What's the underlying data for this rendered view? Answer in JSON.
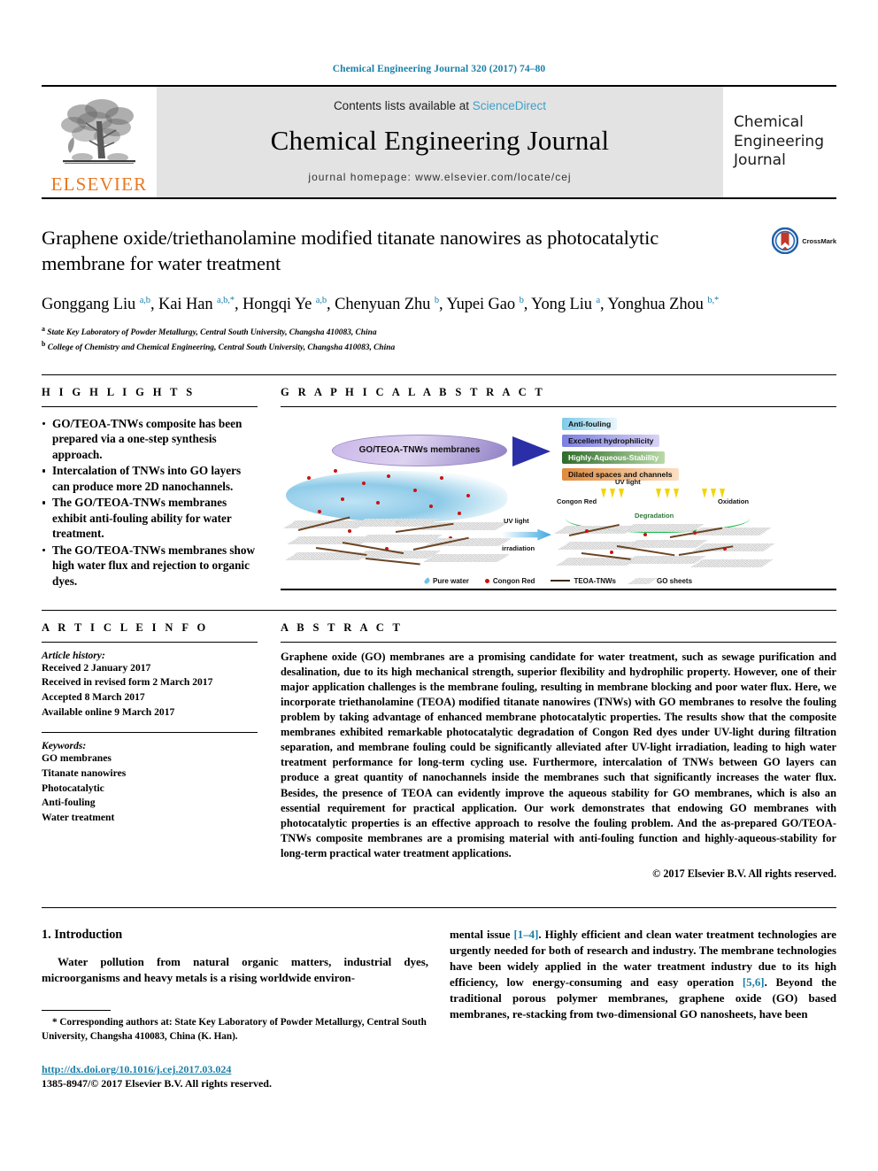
{
  "running_head": "Chemical Engineering Journal 320 (2017) 74–80",
  "masthead": {
    "publisher_wordmark": "ELSEVIER",
    "contents_prefix": "Contents lists available at ",
    "contents_link": "ScienceDirect",
    "journal_title": "Chemical Engineering Journal",
    "homepage": "journal homepage: www.elsevier.com/locate/cej",
    "journal_side_line1": "Chemical",
    "journal_side_line2": "Engineering",
    "journal_side_line3": "Journal"
  },
  "article": {
    "title": "Graphene oxide/triethanolamine modified titanate nanowires as photocatalytic membrane for water treatment",
    "crossmark_label": "CrossMark",
    "authors_html": "Gonggang Liu <sup>a,b</sup>, Kai Han <sup>a,b,</sup><sup>*</sup>, Hongqi Ye <sup>a,b</sup>, Chenyuan Zhu <sup>b</sup>, Yupei Gao <sup>b</sup>, Yong Liu <sup>a</sup>, Yonghua Zhou <sup>b,</sup><sup>*</sup>",
    "affiliation_a": "State Key Laboratory of Powder Metallurgy, Central South University, Changsha 410083, China",
    "affiliation_b": "College of Chemistry and Chemical Engineering, Central South University, Changsha 410083, China"
  },
  "sections": {
    "highlights_heading": "H I G H L I G H T S",
    "graphical_abstract_heading": "G R A P H I C A L   A B S T R A C T",
    "article_info_heading": "A R T I C L E   I N F O",
    "abstract_heading": "A B S T R A C T"
  },
  "highlights": [
    "GO/TEOA-TNWs composite has been prepared via a one-step synthesis approach.",
    "Intercalation of TNWs into GO layers can produce more 2D nanochannels.",
    "The GO/TEOA-TNWs membranes exhibit anti-fouling ability for water treatment.",
    "The GO/TEOA-TNWs membranes show high water flux and rejection to organic dyes."
  ],
  "graphical_abstract": {
    "membrane_label": "GO/TEOA-TNWs membranes",
    "badges": [
      "Anti-fouling",
      "Excellent hydrophilicity",
      "Highly-Aqueous-Stability",
      "Dilated spaces and channels"
    ],
    "uv_light_label": "UV light",
    "uv_irradiation_line1": "UV light",
    "uv_irradiation_line2": "irradiation",
    "congon_red_label": "Congon Red",
    "oxidation_label": "Oxidation",
    "degradation_label": "Degradation",
    "legend": [
      "Pure water",
      "Congon Red",
      "TEOA-TNWs",
      "GO sheets"
    ]
  },
  "article_info": {
    "history_label": "Article history:",
    "history": [
      "Received 2 January 2017",
      "Received in revised form 2 March 2017",
      "Accepted 8 March 2017",
      "Available online 9 March 2017"
    ],
    "keywords_label": "Keywords:",
    "keywords": [
      "GO membranes",
      "Titanate nanowires",
      "Photocatalytic",
      "Anti-fouling",
      "Water treatment"
    ]
  },
  "abstract": {
    "text": "Graphene oxide (GO) membranes are a promising candidate for water treatment, such as sewage purification and desalination, due to its high mechanical strength, superior flexibility and hydrophilic property. However, one of their major application challenges is the membrane fouling, resulting in membrane blocking and poor water flux. Here, we incorporate triethanolamine (TEOA) modified titanate nanowires (TNWs) with GO membranes to resolve the fouling problem by taking advantage of enhanced membrane photocatalytic properties. The results show that the composite membranes exhibited remarkable photocatalytic degradation of Congon Red dyes under UV-light during filtration separation, and membrane fouling could be significantly alleviated after UV-light irradiation, leading to high water treatment performance for long-term cycling use. Furthermore, intercalation of TNWs between GO layers can produce a great quantity of nanochannels inside the membranes such that significantly increases the water flux. Besides, the presence of TEOA can evidently improve the aqueous stability for GO membranes, which is also an essential requirement for practical application. Our work demonstrates that endowing GO membranes with photocatalytic properties is an effective approach to resolve the fouling problem. And the as-prepared GO/TEOA-TNWs composite membranes are a promising material with anti-fouling function and highly-aqueous-stability for long-term practical water treatment applications.",
    "copyright": "© 2017 Elsevier B.V. All rights reserved."
  },
  "introduction": {
    "heading": "1. Introduction",
    "left_paragraph": "Water pollution from natural organic matters, industrial dyes, microorganisms and heavy metals is a rising worldwide environ-",
    "right_paragraph_part1": "mental issue ",
    "right_citation1": "[1–4]",
    "right_paragraph_part2": ". Highly efficient and clean water treatment technologies are urgently needed for both of research and industry. The membrane technologies have been widely applied in the water treatment industry due to its high efficiency, low energy-consuming and easy operation ",
    "right_citation2": "[5,6]",
    "right_paragraph_part3": ". Beyond the traditional porous polymer membranes, graphene oxide (GO) based membranes, re-stacking from two-dimensional GO nanosheets, have been"
  },
  "footer": {
    "corresponding_marker": "*",
    "corresponding_note": "Corresponding authors at: State Key Laboratory of Powder Metallurgy, Central South University, Changsha 410083, China (K. Han).",
    "doi": "http://dx.doi.org/10.1016/j.cej.2017.03.024",
    "issn_line": "1385-8947/© 2017 Elsevier B.V. All rights reserved."
  },
  "colors": {
    "link_blue": "#1a7fa8",
    "elsevier_orange": "#e87722",
    "banner_gray": "#e3e3e3"
  }
}
